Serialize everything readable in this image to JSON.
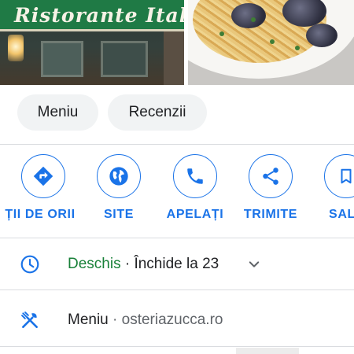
{
  "photos": {
    "sign_text": "Ristorante Ital"
  },
  "chips": [
    {
      "label": "Meniu"
    },
    {
      "label": "Recenzii"
    }
  ],
  "actions": [
    {
      "label": "ȚII DE ORII",
      "icon": "directions-icon"
    },
    {
      "label": "SITE",
      "icon": "globe-icon"
    },
    {
      "label": "APELAȚI",
      "icon": "phone-icon"
    },
    {
      "label": "TRIMITE",
      "icon": "share-icon"
    },
    {
      "label": "SALV",
      "icon": "bookmark-icon"
    }
  ],
  "hours": {
    "status": "Deschis",
    "detail": " · Închide la 23"
  },
  "menu_row": {
    "label": "Meniu",
    "separator": " · ",
    "url": "osteriazucca.ro"
  },
  "colors": {
    "accent": "#1a73e8",
    "open": "#188038",
    "chip_bg": "#f1f3f4",
    "divider": "#dadce0"
  }
}
